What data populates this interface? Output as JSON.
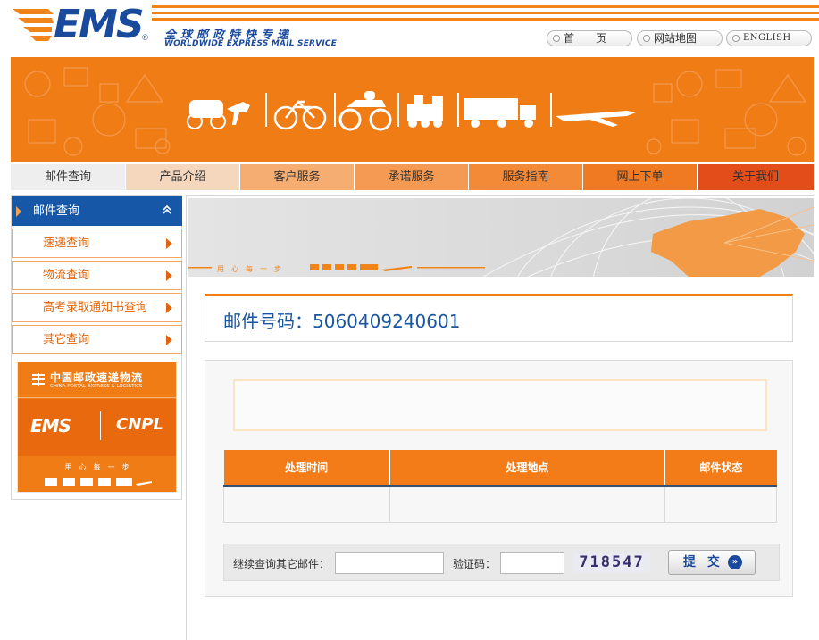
{
  "header": {
    "logo_text": "EMS",
    "logo_reg": "®",
    "logo_cn": "全球邮政特快专递",
    "logo_en": "WORLDWIDE EXPRESS MAIL SERVICE",
    "links": [
      {
        "label": "首　　页"
      },
      {
        "label": "网站地图"
      },
      {
        "label": "ENGLISH"
      }
    ]
  },
  "nav": {
    "items": [
      {
        "label": "邮件查询",
        "bg": "#eeeeee"
      },
      {
        "label": "产品介绍",
        "bg": "#f5d7be"
      },
      {
        "label": "客户服务",
        "bg": "#f6ad72"
      },
      {
        "label": "承诺服务",
        "bg": "#f49a52"
      },
      {
        "label": "服务指南",
        "bg": "#f28a38"
      },
      {
        "label": "网上下单",
        "bg": "#f07a22"
      },
      {
        "label": "关于我们",
        "bg": "#e34d1a"
      }
    ]
  },
  "sidebar": {
    "active": "邮件查询",
    "items": [
      {
        "label": "速递查询"
      },
      {
        "label": "物流查询"
      },
      {
        "label": "高考录取通知书查询"
      },
      {
        "label": "其它查询"
      }
    ],
    "ad": {
      "cn": "中国邮政速递物流",
      "en": "CHINA POSTAL EXPRESS & LOGISTICS",
      "brand1": "EMS",
      "brand2": "CNPL",
      "slogan": "用　心　每　一　步"
    }
  },
  "main": {
    "banner_slogan": "用　心　每　一　步",
    "mail_label": "邮件号码：",
    "mail_number": "5060409240601",
    "table": {
      "headers": [
        "处理时间",
        "处理地点",
        "邮件状态"
      ]
    },
    "search": {
      "continue_label": "继续查询其它邮件：",
      "continue_value": "",
      "captcha_label": "验证码：",
      "captcha_value": "",
      "captcha_text": "718547",
      "submit_label": "提 交"
    }
  },
  "colors": {
    "orange": "#ef7c15",
    "blue": "#1757a7",
    "table_header": "#f37b18"
  }
}
